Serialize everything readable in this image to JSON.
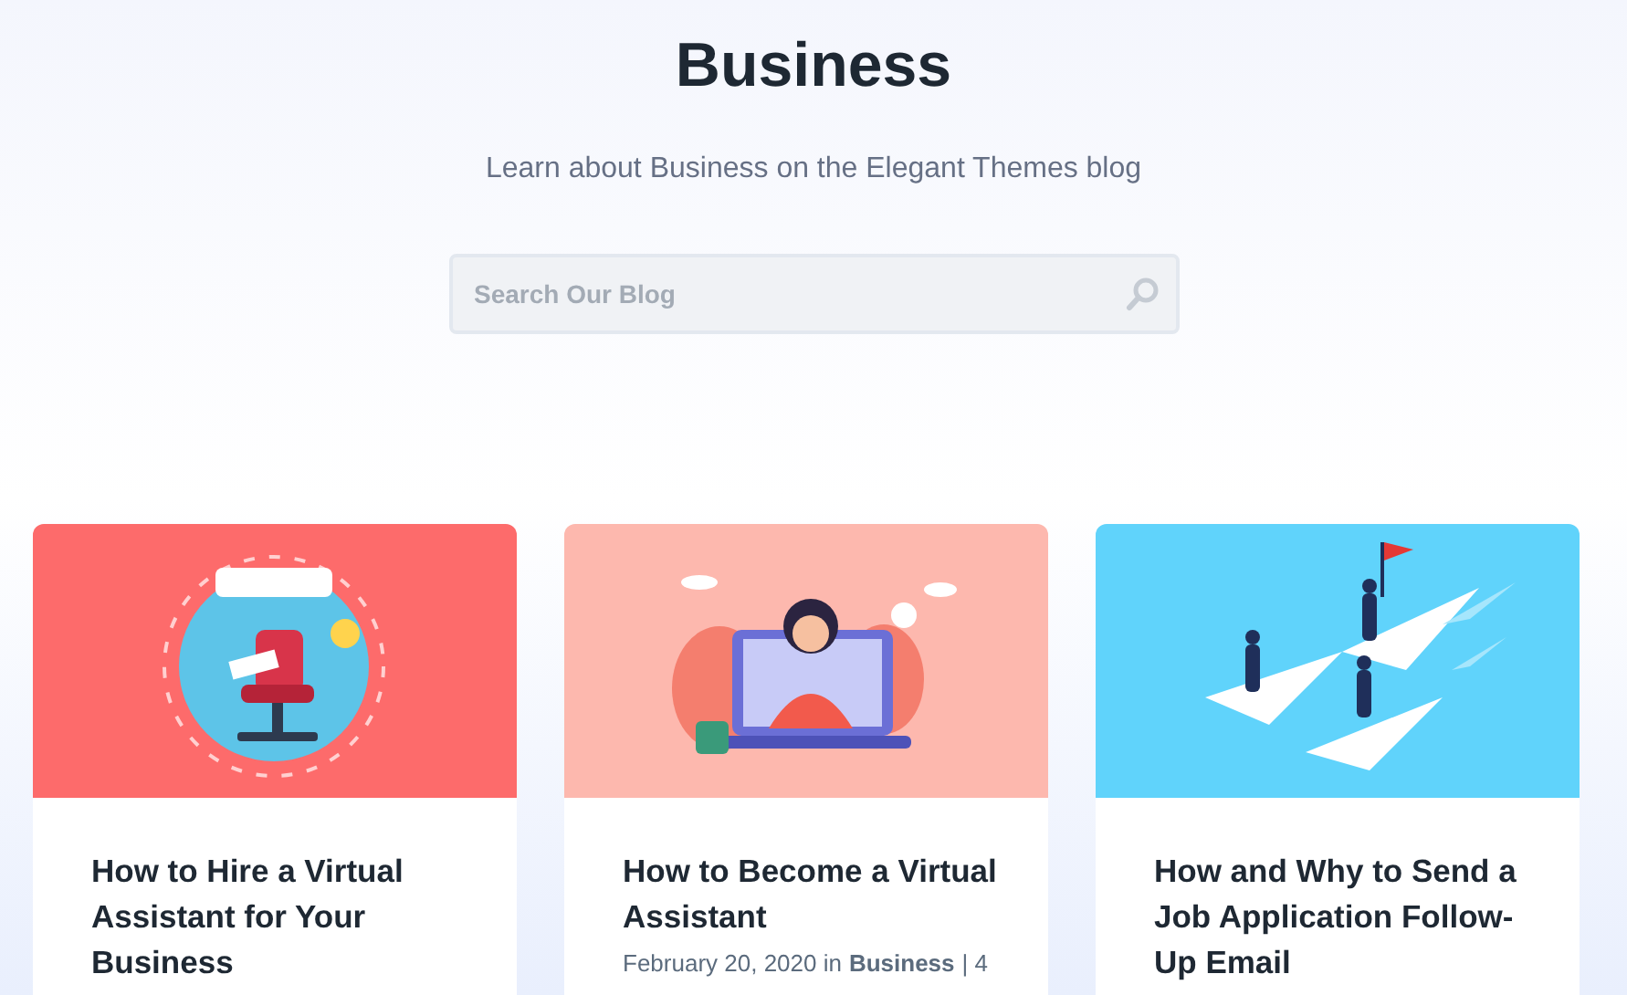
{
  "header": {
    "title": "Business",
    "subtitle": "Learn about Business on the Elegant Themes blog"
  },
  "search": {
    "placeholder": "Search Our Blog"
  },
  "posts": [
    {
      "title": "How to Hire a Virtual Assistant for Your Business"
    },
    {
      "title": "How to Become a Virtual Assistant",
      "meta": {
        "prefix": "February 20, 2020 in",
        "category": "Business",
        "suffix": "| 4"
      }
    },
    {
      "title": "How and Why to Send a Job Application Follow-Up Email"
    }
  ]
}
